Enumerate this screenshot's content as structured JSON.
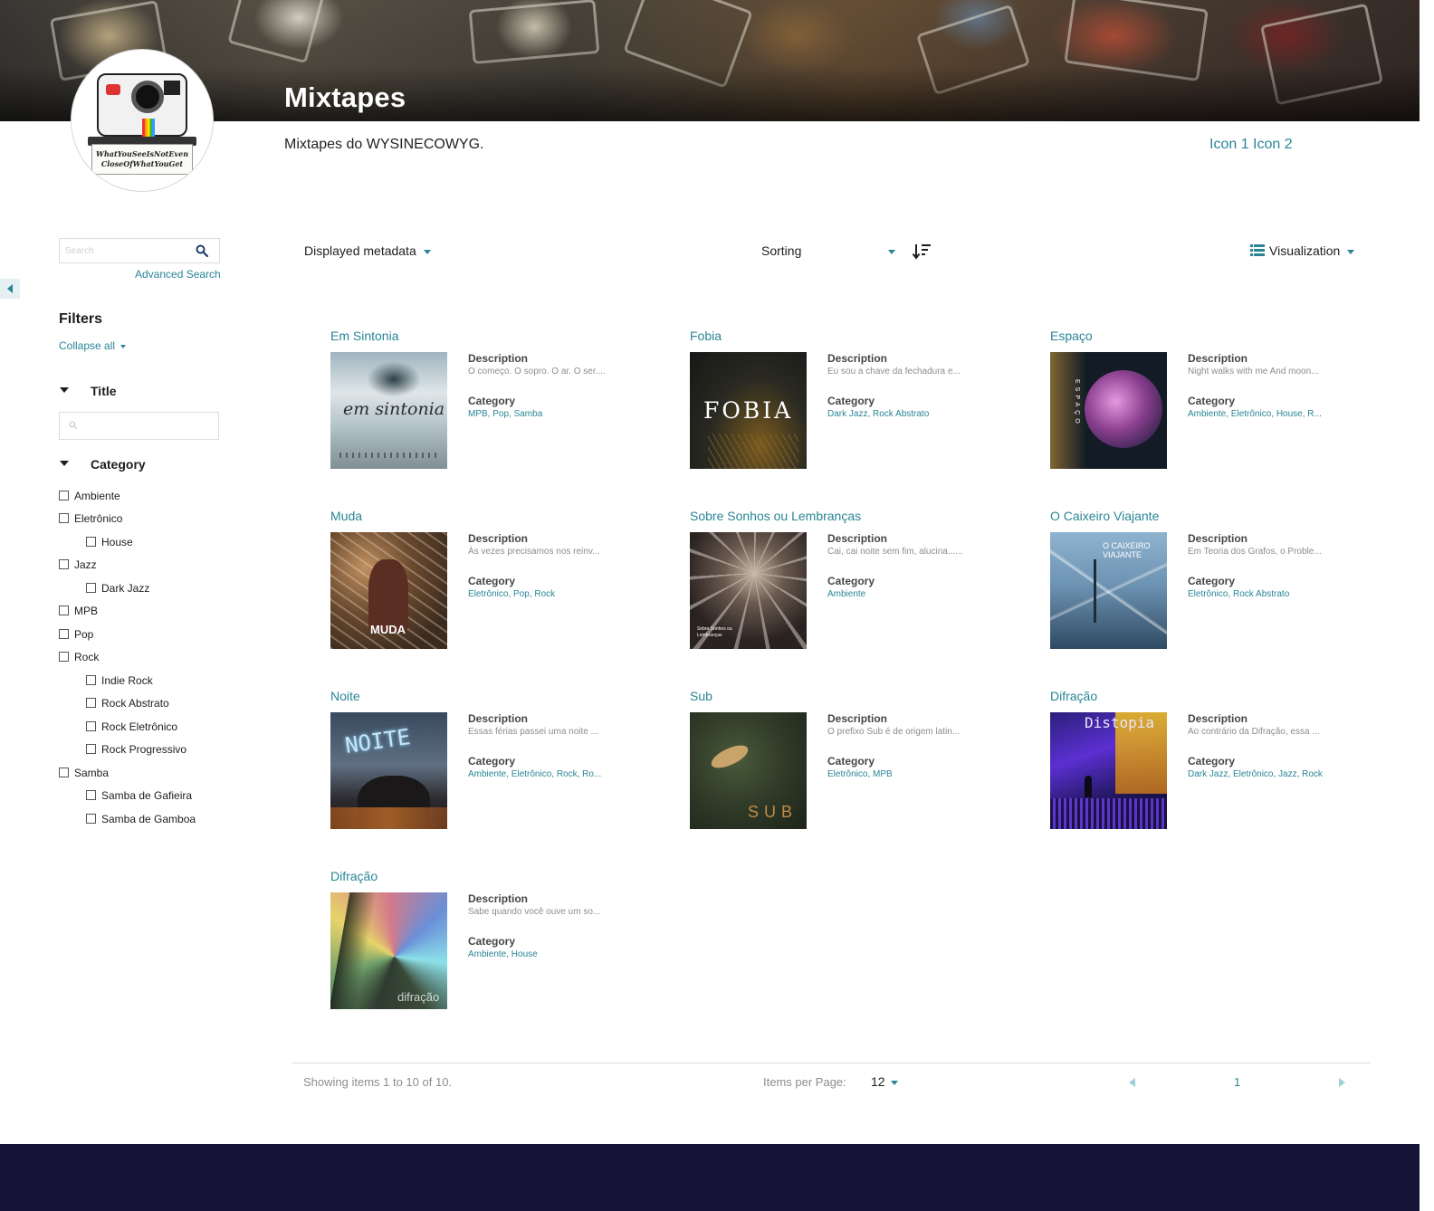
{
  "header": {
    "title": "Mixtapes",
    "description": "Mixtapes do WYSINECOWYG.",
    "icon_1": "Icon 1",
    "icon_2": "Icon 2",
    "logo_text_1": "WhatYouSeeIsNotEven",
    "logo_text_2": "CloseOfWhatYouGet"
  },
  "sidebar": {
    "search_placeholder": "Search",
    "advanced_search": "Advanced Search",
    "filters_title": "Filters",
    "collapse_all": "Collapse all",
    "title_facet": "Title",
    "category_facet": "Category",
    "categories": [
      {
        "label": "Ambiente"
      },
      {
        "label": "Eletrônico"
      },
      {
        "label": "House"
      },
      {
        "label": "Jazz"
      },
      {
        "label": "Dark Jazz"
      },
      {
        "label": "MPB"
      },
      {
        "label": "Pop"
      },
      {
        "label": "Rock"
      },
      {
        "label": "Indie Rock"
      },
      {
        "label": "Rock Abstrato"
      },
      {
        "label": "Rock Eletrônico"
      },
      {
        "label": "Rock Progressivo"
      },
      {
        "label": "Samba"
      },
      {
        "label": "Samba de Gafieira"
      },
      {
        "label": "Samba de Gamboa"
      }
    ]
  },
  "toolbar": {
    "displayed_metadata": "Displayed metadata",
    "sorting": "Sorting",
    "visualization": "Visualization"
  },
  "items": [
    {
      "title": "Em Sintonia",
      "description_label": "Description",
      "description": "O começo. O sopro. O ar. O ser....",
      "category_label": "Category",
      "categories": "MPB, Pop, Samba",
      "cover_text": "em sintonia"
    },
    {
      "title": "Fobia",
      "description_label": "Description",
      "description": "Eu sou a chave da fechadura e...",
      "category_label": "Category",
      "categories": "Dark Jazz, Rock Abstrato",
      "cover_text": "FOBIA"
    },
    {
      "title": "Espaço",
      "description_label": "Description",
      "description": "Night walks with me And moon...",
      "category_label": "Category",
      "categories": "Ambiente, Eletrônico, House, R...",
      "cover_text": "ESPAÇO"
    },
    {
      "title": "Muda",
      "description_label": "Description",
      "description": "Às vezes precisamos nos reinv...",
      "category_label": "Category",
      "categories": "Eletrônico, Pop, Rock",
      "cover_text": "MUDA"
    },
    {
      "title": "Sobre Sonhos ou Lembranças",
      "description_label": "Description",
      "description": "Cai, cai noite sem fim, alucina......",
      "category_label": "Category",
      "categories": "Ambiente",
      "cover_text": "Sobre Sonhos ou Lembranças"
    },
    {
      "title": "O Caixeiro Viajante",
      "description_label": "Description",
      "description": "Em Teoria dos Grafos, o Proble...",
      "category_label": "Category",
      "categories": "Eletrônico, Rock Abstrato",
      "cover_text": "O CAIXEIRO VIAJANTE"
    },
    {
      "title": "Noite",
      "description_label": "Description",
      "description": "Essas férias passei uma noite ...",
      "category_label": "Category",
      "categories": "Ambiente, Eletrônico, Rock, Ro...",
      "cover_text": "NOITE"
    },
    {
      "title": "Sub",
      "description_label": "Description",
      "description": "O prefixo Sub é de origem latin...",
      "category_label": "Category",
      "categories": "Eletrônico, MPB",
      "cover_text": "SUB"
    },
    {
      "title": "Difração",
      "description_label": "Description",
      "description": "Ao contrário da Difração, essa ...",
      "category_label": "Category",
      "categories": "Dark Jazz, Eletrônico, Jazz, Rock",
      "cover_text": "Distopia"
    },
    {
      "title": "Difração",
      "description_label": "Description",
      "description": "Sabe quando você ouve um so...",
      "category_label": "Category",
      "categories": "Ambiente, House",
      "cover_text": "difração"
    }
  ],
  "pagination": {
    "showing": "Showing items 1 to 10 of 10.",
    "items_per_page_label": "Items per Page:",
    "items_per_page": "12",
    "current_page": "1"
  },
  "colors": {
    "accent": "#298596",
    "footer": "#161339"
  }
}
